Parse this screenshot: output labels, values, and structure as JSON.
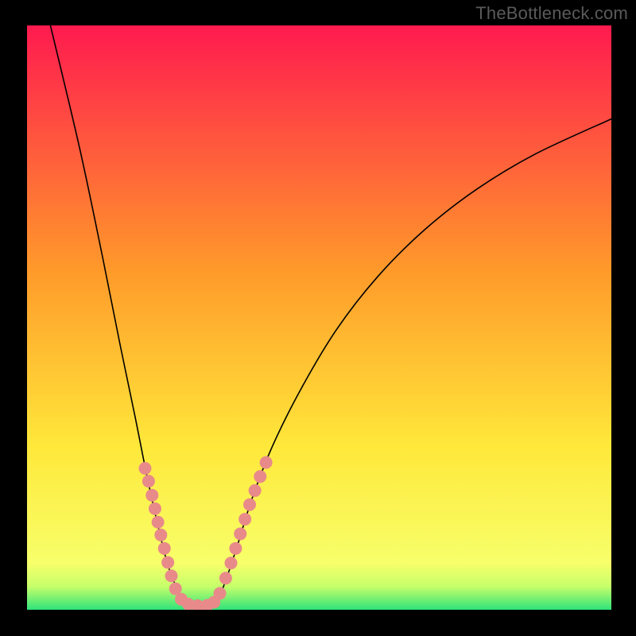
{
  "watermark": "TheBottleneck.com",
  "chart_data": {
    "type": "line",
    "title": "",
    "xlabel": "",
    "ylabel": "",
    "xlim": [
      0,
      100
    ],
    "ylim": [
      0,
      100
    ],
    "grid": false,
    "legend": false,
    "background_gradient_top": "#ff1a4f",
    "background_gradient_mid_upper": "#ff7a2f",
    "background_gradient_mid_lower": "#ffe83a",
    "background_gradient_low": "#f7ff6a",
    "background_bottom_band": "#2fe37a",
    "series": [
      {
        "name": "curve",
        "stroke": "#000000",
        "stroke_width": 1.6,
        "points": [
          {
            "x": 4,
            "y": 100
          },
          {
            "x": 9,
            "y": 79
          },
          {
            "x": 13,
            "y": 60
          },
          {
            "x": 16,
            "y": 45
          },
          {
            "x": 18.5,
            "y": 33
          },
          {
            "x": 20.5,
            "y": 23
          },
          {
            "x": 22.5,
            "y": 14
          },
          {
            "x": 24,
            "y": 8
          },
          {
            "x": 25.5,
            "y": 4
          },
          {
            "x": 27,
            "y": 1.5
          },
          {
            "x": 29,
            "y": 0.7
          },
          {
            "x": 31,
            "y": 0.7
          },
          {
            "x": 32.5,
            "y": 1.5
          },
          {
            "x": 34,
            "y": 5
          },
          {
            "x": 36,
            "y": 11
          },
          {
            "x": 38.5,
            "y": 19
          },
          {
            "x": 42,
            "y": 28
          },
          {
            "x": 47,
            "y": 38
          },
          {
            "x": 53,
            "y": 48
          },
          {
            "x": 60,
            "y": 57
          },
          {
            "x": 68,
            "y": 65
          },
          {
            "x": 77,
            "y": 72
          },
          {
            "x": 87,
            "y": 78
          },
          {
            "x": 100,
            "y": 84
          }
        ]
      },
      {
        "name": "left-dot-cluster",
        "type": "scatter",
        "fill": "#e88a8a",
        "stroke": "none",
        "radius": 8,
        "points": [
          {
            "x": 20.2,
            "y": 24.2
          },
          {
            "x": 20.8,
            "y": 22.0
          },
          {
            "x": 21.4,
            "y": 19.6
          },
          {
            "x": 21.9,
            "y": 17.3
          },
          {
            "x": 22.4,
            "y": 15.0
          },
          {
            "x": 22.9,
            "y": 12.8
          },
          {
            "x": 23.5,
            "y": 10.5
          },
          {
            "x": 24.1,
            "y": 8.1
          },
          {
            "x": 24.7,
            "y": 5.8
          },
          {
            "x": 25.4,
            "y": 3.6
          },
          {
            "x": 26.4,
            "y": 1.8
          },
          {
            "x": 27.6,
            "y": 0.95
          },
          {
            "x": 29.2,
            "y": 0.7
          },
          {
            "x": 30.8,
            "y": 0.75
          },
          {
            "x": 32.0,
            "y": 1.3
          }
        ]
      },
      {
        "name": "right-dot-cluster",
        "type": "scatter",
        "fill": "#e88a8a",
        "stroke": "none",
        "radius": 8,
        "points": [
          {
            "x": 33.0,
            "y": 2.8
          },
          {
            "x": 34.0,
            "y": 5.4
          },
          {
            "x": 34.9,
            "y": 8.0
          },
          {
            "x": 35.7,
            "y": 10.5
          },
          {
            "x": 36.5,
            "y": 13.0
          },
          {
            "x": 37.3,
            "y": 15.5
          },
          {
            "x": 38.1,
            "y": 18.0
          },
          {
            "x": 39.0,
            "y": 20.4
          },
          {
            "x": 39.9,
            "y": 22.8
          },
          {
            "x": 40.9,
            "y": 25.2
          }
        ]
      }
    ]
  }
}
